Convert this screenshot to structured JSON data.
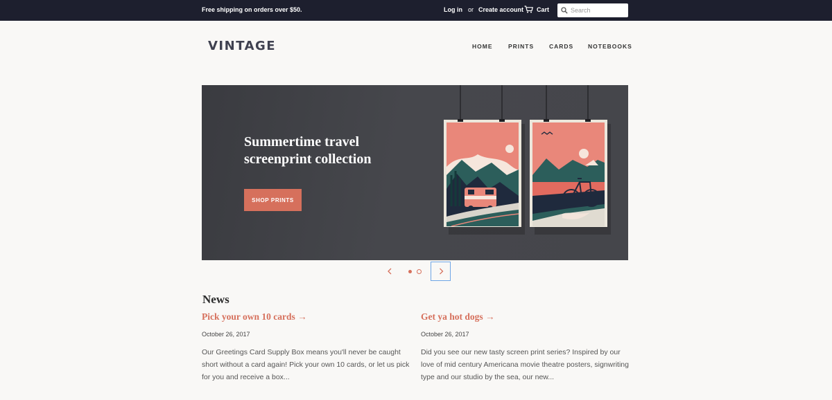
{
  "topbar": {
    "shipping": "Free shipping on orders over $50.",
    "login": "Log in",
    "or": "or",
    "create_account": "Create account",
    "cart": "Cart",
    "search_placeholder": "Search"
  },
  "header": {
    "logo": "VINTAGE",
    "nav": [
      "HOME",
      "PRINTS",
      "CARDS",
      "NOTEBOOKS"
    ]
  },
  "hero": {
    "title": "Summertime travel\nscreenprint collection",
    "button": "SHOP PRINTS",
    "slides": 2,
    "active_slide": 1
  },
  "news": {
    "heading": "News",
    "articles": [
      {
        "title": "Pick your own 10 cards →",
        "date": "October 26, 2017",
        "excerpt": "Our Greetings Card Supply Box means you'll never be caught short without a card again! Pick your own 10 cards, or let us pick for you and receive a box..."
      },
      {
        "title": "Get ya hot dogs →",
        "date": "October 26, 2017",
        "excerpt": "Did you see our new tasty screen print series? Inspired by our love of mid century Americana movie theatre posters, signwriting type and our studio by the sea, our new..."
      }
    ]
  },
  "colors": {
    "topbar_bg": "#1d1f2e",
    "accent": "#d6705c",
    "page_bg": "#f9f8f6"
  },
  "icons": [
    "search-icon",
    "cart-icon",
    "chevron-left-icon",
    "chevron-right-icon"
  ]
}
